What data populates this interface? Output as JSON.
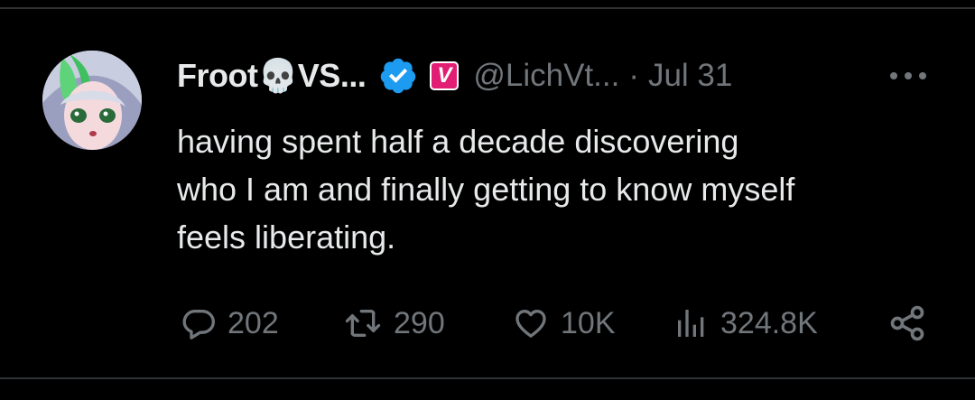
{
  "tweet": {
    "author": {
      "display_name": "Froot💀VS...",
      "handle": "@LichVt...",
      "verified": true,
      "affiliate_badge": "V"
    },
    "separator": "·",
    "timestamp": "Jul 31",
    "text": "having spent half a decade discovering\nwho I am and finally getting to know myself\nfeels liberating.",
    "actions": {
      "replies": "202",
      "retweets": "290",
      "likes": "10K",
      "views": "324.8K"
    }
  },
  "colors": {
    "background": "#000000",
    "text_primary": "#e7e9ea",
    "text_secondary": "#71767b",
    "verified_blue": "#1d9bf0",
    "affiliate_pink": "#e11d74",
    "divider": "#2f3336"
  },
  "icons": {
    "avatar": "anime-avatar",
    "verified": "verified-badge-icon",
    "more": "more-horizontal-icon",
    "reply": "reply-bubble-icon",
    "retweet": "retweet-icon",
    "like": "heart-icon",
    "views": "analytics-bars-icon",
    "share": "share-icon"
  }
}
